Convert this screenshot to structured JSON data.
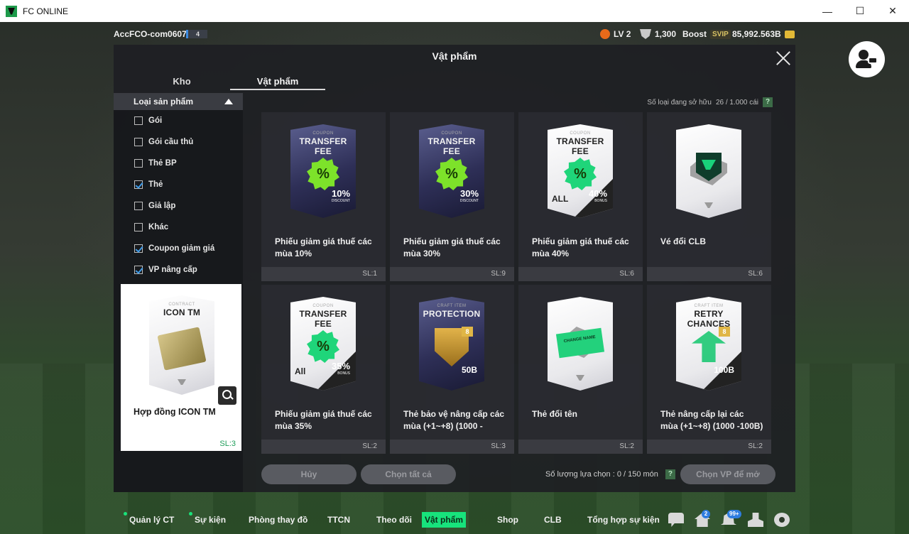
{
  "window": {
    "title": "FC ONLINE"
  },
  "topbar": {
    "account": "AccFCO-com0607f",
    "account_level": "4",
    "lv": "LV 2",
    "points": "1,300",
    "boost": "Boost",
    "svip": "SVIP",
    "bp": "85,992.563B"
  },
  "modal": {
    "title": "Vật phẩm",
    "tabs": [
      "Kho",
      "Vật phẩm"
    ],
    "owned_label": "Số loại đang sở hữu",
    "owned_value": "26 / 1.000 cái",
    "help": "?"
  },
  "filter": {
    "header": "Loại sản phẩm",
    "items": [
      {
        "label": "Gói",
        "checked": false
      },
      {
        "label": "Gói cầu thủ",
        "checked": false
      },
      {
        "label": "Thẻ BP",
        "checked": false
      },
      {
        "label": "Thẻ",
        "checked": true
      },
      {
        "label": "Giả lập",
        "checked": false
      },
      {
        "label": "Khác",
        "checked": false
      },
      {
        "label": "Coupon giảm giá",
        "checked": true
      },
      {
        "label": "VP nâng cấp",
        "checked": true
      }
    ]
  },
  "preview": {
    "card_top": "CONTRACT",
    "card_main": "ICON TM",
    "name": "Hợp đồng ICON TM",
    "qty": "SL:3"
  },
  "items": [
    {
      "name": "Phiếu giảm giá thuế các mùa 10%",
      "qty": "SL:1",
      "card_top": "COUPON",
      "card_main": "TRANSFER FEE",
      "pct": "10",
      "pct_sub": "DISCOUNT",
      "style": "dark"
    },
    {
      "name": "Phiếu giảm giá thuế các mùa 30%",
      "qty": "SL:9",
      "card_top": "COUPON",
      "card_main": "TRANSFER FEE",
      "pct": "30",
      "pct_sub": "DISCOUNT",
      "style": "dark"
    },
    {
      "name": "Phiếu giảm giá thuế các mùa 40%",
      "qty": "SL:6",
      "card_top": "COUPON",
      "card_main": "TRANSFER FEE",
      "pct": "40",
      "pct_sub": "BONUS",
      "all": "ALL",
      "style": "white"
    },
    {
      "name": "Vé đổi CLB",
      "qty": "SL:6",
      "style": "club"
    },
    {
      "name": "Phiếu giảm giá thuế các mùa 35%",
      "qty": "SL:2",
      "card_top": "COUPON",
      "card_main": "TRANSFER FEE",
      "pct": "35",
      "pct_sub": "BONUS",
      "all": "All",
      "style": "white"
    },
    {
      "name": "Thẻ bảo vệ nâng cấp các mùa (+1~+8) (1000 -",
      "qty": "SL:3",
      "card_top": "CRAFT ITEM",
      "card_main": "PROTECTION",
      "value": "50B",
      "tag": "8",
      "style": "protect"
    },
    {
      "name": "Thẻ đổi tên",
      "qty": "SL:2",
      "ticket": "CHANGE NAME",
      "style": "rename"
    },
    {
      "name": "Thẻ nâng cấp lại các mùa (+1~+8) (1000 -100B)",
      "qty": "SL:2",
      "card_top": "CRAFT ITEM",
      "card_main": "RETRY CHANCES",
      "value": "100B",
      "tag": "8",
      "style": "retry"
    }
  ],
  "footer": {
    "cancel": "Hủy",
    "select_all": "Chọn tất cả",
    "select_count_label": "Số lượng lựa chọn : 0 / 150 món",
    "help": "?",
    "open": "Chọn VP để mở"
  },
  "bottom_nav": {
    "items": [
      "Quản lý CT",
      "Sự kiện",
      "Phòng thay đồ",
      "TTCN",
      "Theo dõi",
      "Vật phẩm",
      "Shop",
      "CLB",
      "Tổng hợp sự kiện"
    ],
    "active": "Vật phẩm",
    "home_badge": "2",
    "bell_badge": "99+"
  }
}
